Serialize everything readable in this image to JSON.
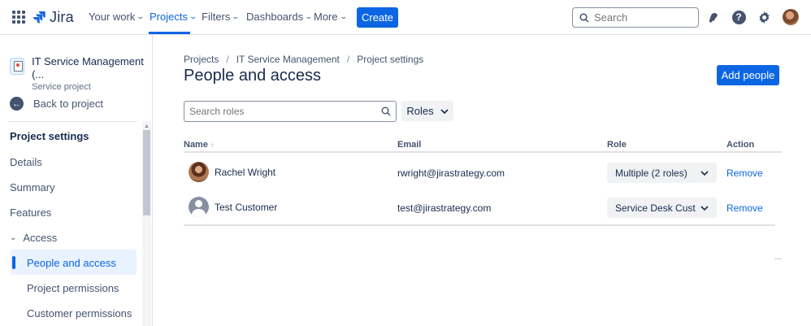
{
  "topnav": {
    "logo": "Jira",
    "items": [
      {
        "label": "Your work"
      },
      {
        "label": "Projects"
      },
      {
        "label": "Filters"
      },
      {
        "label": "Dashboards"
      },
      {
        "label": "More"
      }
    ],
    "create_label": "Create",
    "search_placeholder": "Search"
  },
  "sidebar": {
    "project_name": "IT Service Management (...",
    "project_type": "Service project",
    "back_label": "Back to project",
    "section_heading": "Project settings",
    "items": [
      {
        "label": "Details"
      },
      {
        "label": "Summary"
      },
      {
        "label": "Features"
      }
    ],
    "access_label": "Access",
    "access_items": [
      {
        "label": "People and access"
      },
      {
        "label": "Project permissions"
      },
      {
        "label": "Customer permissions"
      }
    ]
  },
  "breadcrumbs": [
    "Projects",
    "IT Service Management",
    "Project settings"
  ],
  "breadcrumb_separator": "/",
  "page_title": "People and access",
  "add_people_label": "Add people",
  "roles_search_placeholder": "Search roles",
  "roles_filter_label": "Roles",
  "table": {
    "headers": {
      "name": "Name",
      "email": "Email",
      "role": "Role",
      "action": "Action"
    },
    "rows": [
      {
        "name": "Rachel Wright",
        "email": "rwright@jirastrategy.com",
        "role": "Multiple (2 roles)",
        "action": "Remove"
      },
      {
        "name": "Test Customer",
        "email": "test@jirastrategy.com",
        "role": "Service Desk Cust...",
        "action": "Remove"
      }
    ]
  },
  "colors": {
    "accent": "#0c66e4",
    "text": "#172b4d",
    "subtle": "#44546f"
  }
}
